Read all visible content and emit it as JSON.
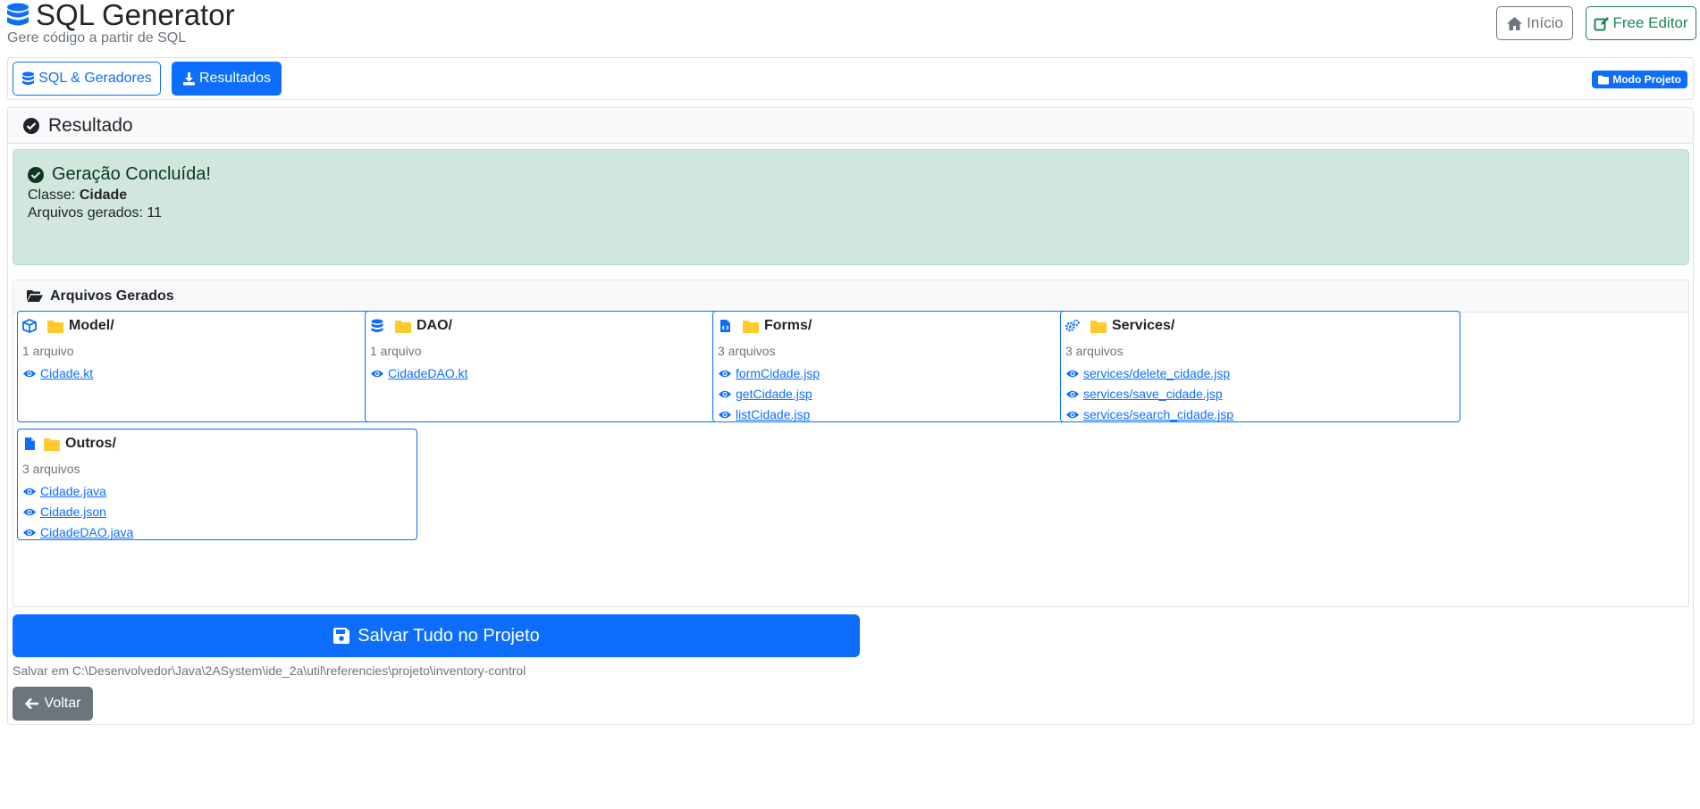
{
  "header": {
    "title": "SQL Generator",
    "subtitle": "Gere código a partir de SQL",
    "home_label": "Início",
    "free_editor_label": "Free Editor"
  },
  "nav": {
    "tab_sql_label": "SQL & Geradores",
    "tab_results_label": "Resultados",
    "mode_badge": "Modo Projeto"
  },
  "result": {
    "title": "Resultado",
    "alert_title": "Geração Concluída!",
    "class_label": "Classe:",
    "class_name": "Cidade",
    "files_count_text": "Arquivos gerados: 11"
  },
  "files": {
    "title": "Arquivos Gerados",
    "folders": [
      {
        "name": "Model/",
        "icon": "cube-icon",
        "count": "1 arquivo",
        "files": [
          "Cidade.kt"
        ]
      },
      {
        "name": "DAO/",
        "icon": "database-icon",
        "count": "1 arquivo",
        "files": [
          "CidadeDAO.kt"
        ]
      },
      {
        "name": "Forms/",
        "icon": "file-code-icon",
        "count": "3 arquivos",
        "files": [
          "formCidade.jsp",
          "getCidade.jsp",
          "listCidade.jsp"
        ]
      },
      {
        "name": "Services/",
        "icon": "gears-icon",
        "count": "3 arquivos",
        "files": [
          "services/delete_cidade.jsp",
          "services/save_cidade.jsp",
          "services/search_cidade.jsp"
        ]
      },
      {
        "name": "Outros/",
        "icon": "file-icon",
        "count": "3 arquivos",
        "files": [
          "Cidade.java",
          "Cidade.json",
          "CidadeDAO.java"
        ]
      }
    ]
  },
  "actions": {
    "save_all_label": "Salvar Tudo no Projeto",
    "save_path": "Salvar em C:\\Desenvolvedor\\Java\\2ASystem\\ide_2a\\util\\referencies\\projeto\\inventory-control",
    "back_label": "Voltar"
  },
  "colors": {
    "primary": "#0d6efd",
    "success": "#198754",
    "secondary": "#6c757d",
    "alert_bg": "#d1e7dd",
    "folder_yellow": "#ffca2c"
  }
}
